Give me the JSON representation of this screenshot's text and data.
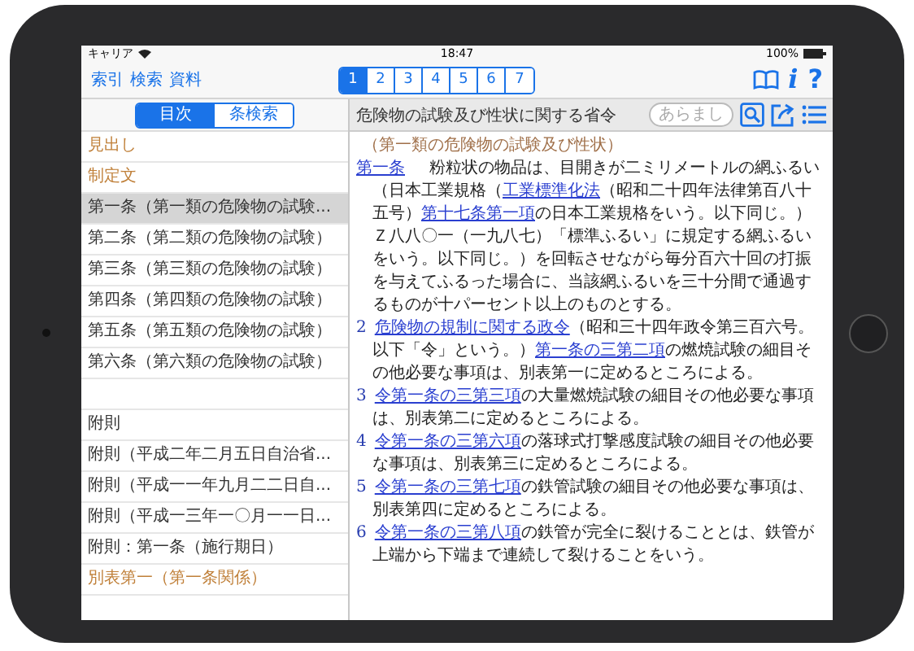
{
  "status_bar": {
    "carrier": "キャリア",
    "time": "18:47",
    "battery": "100%"
  },
  "toolbar": {
    "links": [
      "索引",
      "検索",
      "資料"
    ],
    "page_tabs": [
      {
        "label": "1",
        "selected": true
      },
      {
        "label": "2",
        "selected": false
      },
      {
        "label": "3",
        "selected": false
      },
      {
        "label": "4",
        "selected": false
      },
      {
        "label": "5",
        "selected": false
      },
      {
        "label": "6",
        "selected": false
      },
      {
        "label": "7",
        "selected": false
      }
    ],
    "info": "i",
    "help": "?"
  },
  "sidebar": {
    "segments": [
      {
        "label": "目次",
        "selected": true
      },
      {
        "label": "条検索",
        "selected": false
      }
    ],
    "items": [
      {
        "label": "見出し",
        "kind": "heading",
        "selected": false,
        "gap_before": false
      },
      {
        "label": "制定文",
        "kind": "heading",
        "selected": false,
        "gap_before": false
      },
      {
        "label": "第一条（第一類の危険物の試験...",
        "kind": "entry",
        "selected": true,
        "gap_before": false
      },
      {
        "label": "第二条（第二類の危険物の試験）",
        "kind": "entry",
        "selected": false,
        "gap_before": false
      },
      {
        "label": "第三条（第三類の危険物の試験）",
        "kind": "entry",
        "selected": false,
        "gap_before": false
      },
      {
        "label": "第四条（第四類の危険物の試験）",
        "kind": "entry",
        "selected": false,
        "gap_before": false
      },
      {
        "label": "第五条（第五類の危険物の試験）",
        "kind": "entry",
        "selected": false,
        "gap_before": false
      },
      {
        "label": "第六条（第六類の危険物の試験）",
        "kind": "entry",
        "selected": false,
        "gap_before": false
      },
      {
        "label": "附則",
        "kind": "entry",
        "selected": false,
        "gap_before": true
      },
      {
        "label": "附則（平成二年二月五日自治省...",
        "kind": "entry",
        "selected": false,
        "gap_before": false
      },
      {
        "label": "附則（平成一一年九月二二日自...",
        "kind": "entry",
        "selected": false,
        "gap_before": false
      },
      {
        "label": "附則（平成一三年一〇月一一日...",
        "kind": "entry",
        "selected": false,
        "gap_before": false
      },
      {
        "label": "附則：第一条（施行期日）",
        "kind": "entry",
        "selected": false,
        "gap_before": false
      },
      {
        "label": "別表第一（第一条関係）",
        "kind": "heading",
        "selected": false,
        "gap_before": false
      }
    ]
  },
  "document": {
    "title": "危険物の試験及び性状に関する省令",
    "summary_button": {
      "label": "あらまし",
      "disabled": true
    },
    "heading": "（第一類の危険物の試験及び性状）",
    "paragraphs": [
      {
        "number": "第一条",
        "number_link": true,
        "segments": [
          {
            "text": "　粉粒状の物品は、目開きが二ミリメートルの網ふるい（日本工業規格（",
            "link": false
          },
          {
            "text": "工業標準化法",
            "link": true
          },
          {
            "text": "（昭和二十四年法律第百八十五号）",
            "link": false
          },
          {
            "text": "第十七条第一項",
            "link": true
          },
          {
            "text": "の日本工業規格をいう。以下同じ。）Ｚ八八〇一（一九八七）「標準ふるい」に規定する網ふるいをいう。以下同じ。）を回転させながら毎分百六十回の打振を与えてふるった場合に、当該網ふるいを三十分間で通過するものが十パーセント以上のものとする。",
            "link": false
          }
        ]
      },
      {
        "number": "2",
        "number_link": false,
        "segments": [
          {
            "text": "危険物の規制に関する政令",
            "link": true
          },
          {
            "text": "（昭和三十四年政令第三百六号。以下「令」という。）",
            "link": false
          },
          {
            "text": "第一条の三第二項",
            "link": true
          },
          {
            "text": "の燃焼試験の細目その他必要な事項は、別表第一に定めるところによる。",
            "link": false
          }
        ]
      },
      {
        "number": "3",
        "number_link": false,
        "segments": [
          {
            "text": "令第一条の三第三項",
            "link": true
          },
          {
            "text": "の大量燃焼試験の細目その他必要な事項は、別表第二に定めるところによる。",
            "link": false
          }
        ]
      },
      {
        "number": "4",
        "number_link": false,
        "segments": [
          {
            "text": "令第一条の三第六項",
            "link": true
          },
          {
            "text": "の落球式打撃感度試験の細目その他必要な事項は、別表第三に定めるところによる。",
            "link": false
          }
        ]
      },
      {
        "number": "5",
        "number_link": false,
        "segments": [
          {
            "text": "令第一条の三第七項",
            "link": true
          },
          {
            "text": "の鉄管試験の細目その他必要な事項は、別表第四に定めるところによる。",
            "link": false
          }
        ]
      },
      {
        "number": "6",
        "number_link": false,
        "segments": [
          {
            "text": "令第一条の三第八項",
            "link": true
          },
          {
            "text": "の鉄管が完全に裂けることとは、鉄管が上端から下端まで連続して裂けることをいう。",
            "link": false
          }
        ]
      }
    ]
  }
}
